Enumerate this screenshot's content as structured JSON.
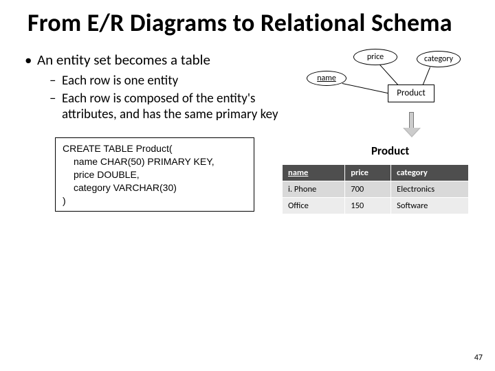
{
  "title": "From E/R Diagrams to Relational Schema",
  "bullet_main": "An entity set becomes a table",
  "sub1": "Each row is one entity",
  "sub2": "Each row is composed of the entity's attributes, and has the same primary key",
  "code": {
    "l1": "CREATE TABLE Product(",
    "l2": "name     CHAR(50) PRIMARY KEY,",
    "l3": "price    DOUBLE,",
    "l4": "category VARCHAR(30)",
    "l5": ")"
  },
  "er": {
    "attr_price": "price",
    "attr_category": "category",
    "attr_name": "name",
    "entity": "Product"
  },
  "table_title": "Product",
  "table": {
    "headers": {
      "c0": "name",
      "c1": "price",
      "c2": "category"
    },
    "rows": [
      {
        "c0": "i. Phone",
        "c1": "700",
        "c2": "Electronics"
      },
      {
        "c0": "Office",
        "c1": "150",
        "c2": "Software"
      }
    ]
  },
  "pagenum": "47"
}
